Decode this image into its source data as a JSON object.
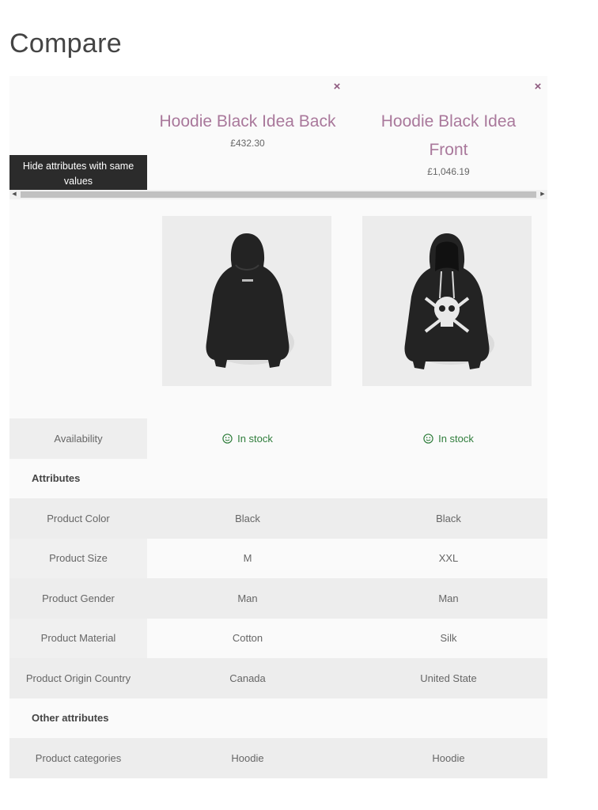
{
  "page": {
    "title": "Compare"
  },
  "controls": {
    "hide_same_label": "Hide attributes with same values",
    "remove_icon": "×"
  },
  "scrollbar": {
    "left_arrow": "◀",
    "right_arrow": "▶"
  },
  "products": [
    {
      "name": "Hoodie Black Idea Back",
      "price": "£432.30",
      "image_icon": "hoodie-back-image"
    },
    {
      "name_line1": "Hoodie Black Idea",
      "name_line2": "Front",
      "price": "£1,046.19",
      "image_icon": "hoodie-front-image"
    }
  ],
  "availability": {
    "label": "Availability",
    "values": [
      "In stock",
      "In stock"
    ],
    "color": "#2f7d3b"
  },
  "sections": {
    "attributes": "Attributes",
    "other_attributes": "Other attributes"
  },
  "rows": {
    "color": {
      "label": "Product Color",
      "values": [
        "Black",
        "Black"
      ]
    },
    "size": {
      "label": "Product Size",
      "values": [
        "M",
        "XXL"
      ]
    },
    "gender": {
      "label": "Product Gender",
      "values": [
        "Man",
        "Man"
      ]
    },
    "material": {
      "label": "Product Material",
      "values": [
        "Cotton",
        "Silk"
      ]
    },
    "origin": {
      "label": "Product Origin Country",
      "values": [
        "Canada",
        "United State"
      ]
    },
    "categories": {
      "label": "Product categories",
      "values": [
        "Hoodie",
        "Hoodie"
      ]
    }
  },
  "colors": {
    "accent": "#a9789b",
    "remove": "#8e5a7f",
    "button_bg": "#2b2b2b"
  }
}
